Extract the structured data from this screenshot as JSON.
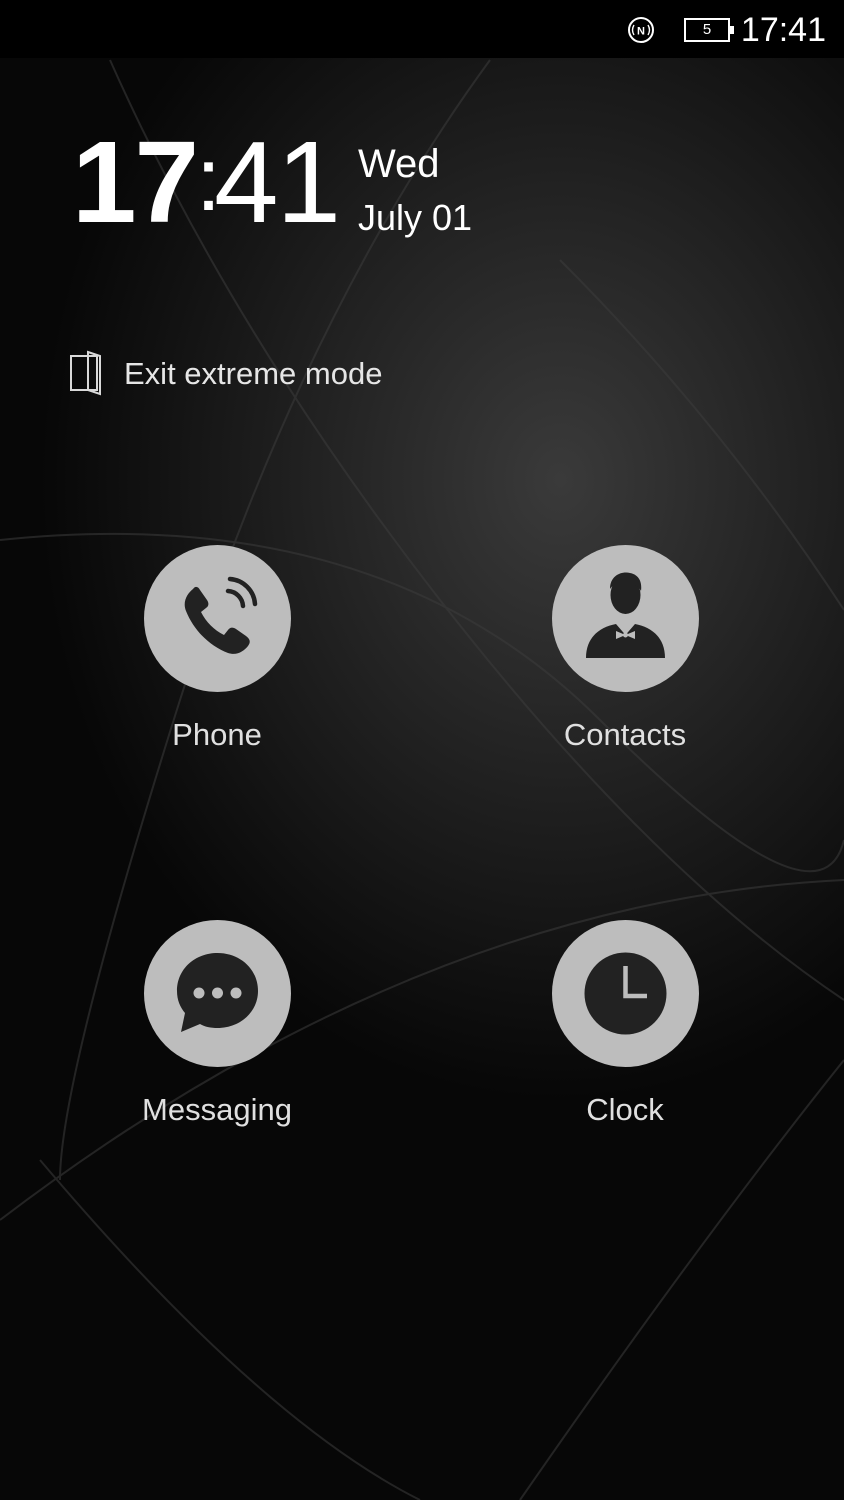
{
  "status_bar": {
    "time": "17:41",
    "battery_level": "5",
    "icons": [
      "nfc-icon",
      "battery-icon"
    ]
  },
  "clock_widget": {
    "hour": "17",
    "separator": ":",
    "minute": "41",
    "day": "Wed",
    "date": "July 01"
  },
  "exit_mode": {
    "label": "Exit extreme mode",
    "icon": "door-exit-icon"
  },
  "apps": [
    {
      "label": "Phone",
      "icon": "phone-icon"
    },
    {
      "label": "Contacts",
      "icon": "contact-person-icon"
    },
    {
      "label": "Messaging",
      "icon": "message-bubble-icon"
    },
    {
      "label": "Clock",
      "icon": "clock-icon"
    }
  ],
  "colors": {
    "icon_circle": "#bdbdbd",
    "icon_glyph": "#222222",
    "text": "#e6e6e6",
    "status_bar_bg": "#000000"
  }
}
